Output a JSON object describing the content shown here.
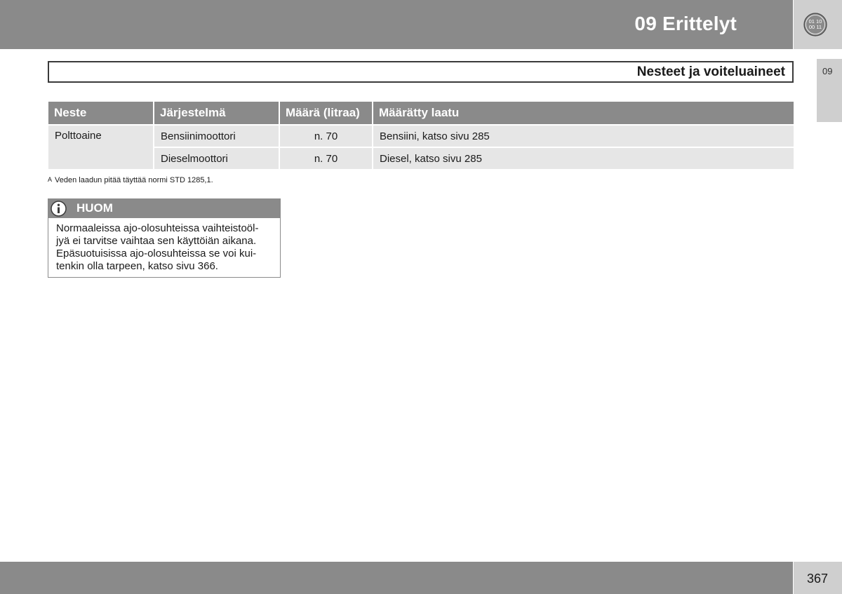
{
  "header": {
    "chapter_title": "09 Erittelyt",
    "chapter_icon": {
      "name": "chapter-index-icon",
      "text_top": "01 10",
      "text_bottom": "00 11"
    }
  },
  "side_tab": {
    "label": "09"
  },
  "section": {
    "title": "Nesteet ja voiteluaineet"
  },
  "table": {
    "headers": [
      "Neste",
      "Järjestelmä",
      "Määrä (litraa)",
      "Määrätty laatu"
    ],
    "rows": [
      {
        "neste": "Polttoaine",
        "jarjestelma": "Bensiinimoottori",
        "maara": "n. 70",
        "laatu": "Bensiini, katso sivu 285"
      },
      {
        "neste": "",
        "jarjestelma": "Dieselmoottori",
        "maara": "n. 70",
        "laatu": "Diesel, katso sivu 285"
      }
    ]
  },
  "footnote": {
    "marker": "A",
    "text": "Veden laadun pitää täyttää normi STD 1285,1."
  },
  "note": {
    "title": "HUOM",
    "icon": "info-icon",
    "lines": [
      "Normaaleissa ajo-olosuhteissa vaihteistoöl-",
      "jyä ei tarvitse vaihtaa sen käyttöiän aikana.",
      "Epäsuotuisissa ajo-olosuhteissa se voi kui-",
      "tenkin olla tarpeen, katso sivu 366."
    ]
  },
  "footer": {
    "page_number": "367"
  },
  "colors": {
    "band_gray": "#8a8a8a",
    "light_gray": "#cfcfcf",
    "cell_gray": "#e6e6e6"
  }
}
